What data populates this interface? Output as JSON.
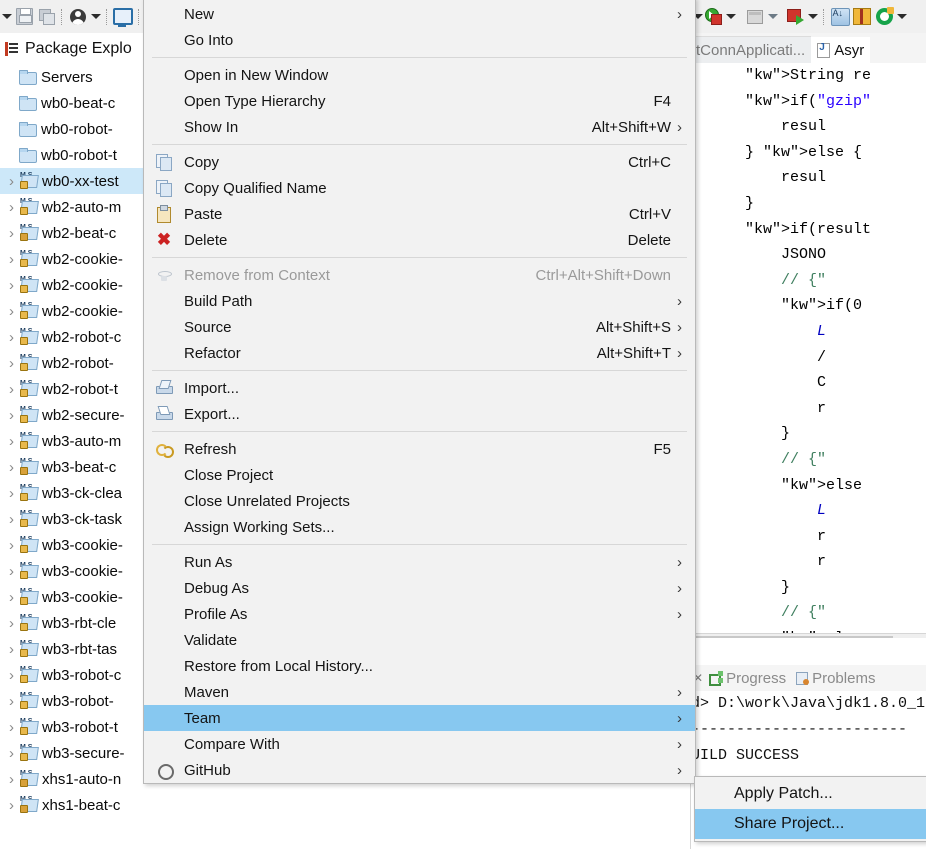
{
  "toolbar": {
    "left_icons": [
      "save-icon",
      "save-all-icon",
      "person-icon",
      "dropdown-arrow",
      "screen-icon"
    ],
    "right_icons": [
      "run-icon",
      "run-dropdown-arrow",
      "external-tools-icon",
      "external-dropdown-arrow",
      "debug-icon",
      "debug-dropdown-arrow",
      "sort-members-icon",
      "new-package-icon",
      "green-refresh-icon"
    ]
  },
  "package_explorer": {
    "title": "Package Explo",
    "items": [
      {
        "label": "Servers",
        "icon": "folder-icon",
        "twisty": false,
        "selected": false,
        "kind": "folder"
      },
      {
        "label": "wb0-beat-c",
        "icon": "folder-icon",
        "twisty": false,
        "selected": false,
        "kind": "folder"
      },
      {
        "label": "wb0-robot-",
        "icon": "folder-icon",
        "twisty": false,
        "selected": false,
        "kind": "folder"
      },
      {
        "label": "wb0-robot-t",
        "icon": "folder-icon",
        "twisty": false,
        "selected": false,
        "kind": "folder"
      },
      {
        "label": "wb0-xx-test",
        "icon": "maven-project-icon",
        "twisty": true,
        "selected": true,
        "kind": "project"
      },
      {
        "label": "wb2-auto-m",
        "icon": "maven-project-icon",
        "twisty": true,
        "selected": false,
        "kind": "project"
      },
      {
        "label": "wb2-beat-c",
        "icon": "maven-project-icon",
        "twisty": true,
        "selected": false,
        "kind": "project-warn"
      },
      {
        "label": "wb2-cookie-",
        "icon": "maven-project-icon",
        "twisty": true,
        "selected": false,
        "kind": "project"
      },
      {
        "label": "wb2-cookie-",
        "icon": "maven-project-icon",
        "twisty": true,
        "selected": false,
        "kind": "project"
      },
      {
        "label": "wb2-cookie-",
        "icon": "maven-project-icon",
        "twisty": true,
        "selected": false,
        "kind": "project"
      },
      {
        "label": "wb2-robot-c",
        "icon": "maven-project-icon",
        "twisty": true,
        "selected": false,
        "kind": "project"
      },
      {
        "label": "wb2-robot-",
        "icon": "maven-project-icon",
        "twisty": true,
        "selected": false,
        "kind": "project"
      },
      {
        "label": "wb2-robot-t",
        "icon": "maven-project-icon",
        "twisty": true,
        "selected": false,
        "kind": "project"
      },
      {
        "label": "wb2-secure-",
        "icon": "maven-project-icon",
        "twisty": true,
        "selected": false,
        "kind": "project"
      },
      {
        "label": "wb3-auto-m",
        "icon": "maven-project-icon",
        "twisty": true,
        "selected": false,
        "kind": "project"
      },
      {
        "label": "wb3-beat-c",
        "icon": "maven-project-icon",
        "twisty": true,
        "selected": false,
        "kind": "project-warn"
      },
      {
        "label": "wb3-ck-clea",
        "icon": "maven-project-icon",
        "twisty": true,
        "selected": false,
        "kind": "project"
      },
      {
        "label": "wb3-ck-task",
        "icon": "maven-project-icon",
        "twisty": true,
        "selected": false,
        "kind": "project"
      },
      {
        "label": "wb3-cookie-",
        "icon": "maven-project-icon",
        "twisty": true,
        "selected": false,
        "kind": "project"
      },
      {
        "label": "wb3-cookie-",
        "icon": "maven-project-icon",
        "twisty": true,
        "selected": false,
        "kind": "project"
      },
      {
        "label": "wb3-cookie-",
        "icon": "maven-project-icon",
        "twisty": true,
        "selected": false,
        "kind": "project"
      },
      {
        "label": "wb3-rbt-cle",
        "icon": "maven-project-icon",
        "twisty": true,
        "selected": false,
        "kind": "project"
      },
      {
        "label": "wb3-rbt-tas",
        "icon": "maven-project-icon",
        "twisty": true,
        "selected": false,
        "kind": "project"
      },
      {
        "label": "wb3-robot-c",
        "icon": "maven-project-icon",
        "twisty": true,
        "selected": false,
        "kind": "project"
      },
      {
        "label": "wb3-robot-",
        "icon": "maven-project-icon",
        "twisty": true,
        "selected": false,
        "kind": "project"
      },
      {
        "label": "wb3-robot-t",
        "icon": "maven-project-icon",
        "twisty": true,
        "selected": false,
        "kind": "project"
      },
      {
        "label": "wb3-secure-",
        "icon": "maven-project-icon",
        "twisty": true,
        "selected": false,
        "kind": "project"
      },
      {
        "label": "xhs1-auto-n",
        "icon": "maven-project-icon",
        "twisty": true,
        "selected": false,
        "kind": "project-warn"
      },
      {
        "label": "xhs1-beat-c",
        "icon": "maven-project-icon",
        "twisty": true,
        "selected": false,
        "kind": "project-warn"
      }
    ]
  },
  "context_menu": {
    "groups": [
      [
        {
          "label": "New",
          "accel": "",
          "submenu": true,
          "icon": "",
          "disabled": false
        },
        {
          "label": "Go Into",
          "accel": "",
          "submenu": false,
          "icon": "",
          "disabled": false
        }
      ],
      [
        {
          "label": "Open in New Window",
          "accel": "",
          "submenu": false,
          "icon": "",
          "disabled": false
        },
        {
          "label": "Open Type Hierarchy",
          "accel": "F4",
          "submenu": false,
          "icon": "",
          "disabled": false
        },
        {
          "label": "Show In",
          "accel": "Alt+Shift+W",
          "submenu": true,
          "icon": "",
          "disabled": false
        }
      ],
      [
        {
          "label": "Copy",
          "accel": "Ctrl+C",
          "submenu": false,
          "icon": "copy-icon",
          "disabled": false
        },
        {
          "label": "Copy Qualified Name",
          "accel": "",
          "submenu": false,
          "icon": "copy-qualified-icon",
          "disabled": false
        },
        {
          "label": "Paste",
          "accel": "Ctrl+V",
          "submenu": false,
          "icon": "paste-icon",
          "disabled": false
        },
        {
          "label": "Delete",
          "accel": "Delete",
          "submenu": false,
          "icon": "delete-icon",
          "disabled": false
        }
      ],
      [
        {
          "label": "Remove from Context",
          "accel": "Ctrl+Alt+Shift+Down",
          "submenu": false,
          "icon": "remove-context-icon",
          "disabled": true
        },
        {
          "label": "Build Path",
          "accel": "",
          "submenu": true,
          "icon": "",
          "disabled": false
        },
        {
          "label": "Source",
          "accel": "Alt+Shift+S",
          "submenu": true,
          "icon": "",
          "disabled": false
        },
        {
          "label": "Refactor",
          "accel": "Alt+Shift+T",
          "submenu": true,
          "icon": "",
          "disabled": false
        }
      ],
      [
        {
          "label": "Import...",
          "accel": "",
          "submenu": false,
          "icon": "import-icon",
          "disabled": false
        },
        {
          "label": "Export...",
          "accel": "",
          "submenu": false,
          "icon": "export-icon",
          "disabled": false
        }
      ],
      [
        {
          "label": "Refresh",
          "accel": "F5",
          "submenu": false,
          "icon": "refresh-icon",
          "disabled": false
        },
        {
          "label": "Close Project",
          "accel": "",
          "submenu": false,
          "icon": "",
          "disabled": false
        },
        {
          "label": "Close Unrelated Projects",
          "accel": "",
          "submenu": false,
          "icon": "",
          "disabled": false
        },
        {
          "label": "Assign Working Sets...",
          "accel": "",
          "submenu": false,
          "icon": "",
          "disabled": false
        }
      ],
      [
        {
          "label": "Run As",
          "accel": "",
          "submenu": true,
          "icon": "",
          "disabled": false
        },
        {
          "label": "Debug As",
          "accel": "",
          "submenu": true,
          "icon": "",
          "disabled": false
        },
        {
          "label": "Profile As",
          "accel": "",
          "submenu": true,
          "icon": "",
          "disabled": false
        },
        {
          "label": "Validate",
          "accel": "",
          "submenu": false,
          "icon": "",
          "disabled": false
        },
        {
          "label": "Restore from Local History...",
          "accel": "",
          "submenu": false,
          "icon": "",
          "disabled": false
        },
        {
          "label": "Maven",
          "accel": "",
          "submenu": true,
          "icon": "",
          "disabled": false
        },
        {
          "label": "Team",
          "accel": "",
          "submenu": true,
          "icon": "",
          "disabled": false,
          "selected": true
        },
        {
          "label": "Compare With",
          "accel": "",
          "submenu": true,
          "icon": "",
          "disabled": false
        },
        {
          "label": "GitHub",
          "accel": "",
          "submenu": true,
          "icon": "github-icon",
          "disabled": false
        }
      ]
    ]
  },
  "submenu": {
    "items": [
      {
        "label": "Apply Patch...",
        "selected": false
      },
      {
        "label": "Share Project...",
        "selected": true
      }
    ]
  },
  "editor": {
    "tabs": [
      {
        "label": "tConnApplicati...",
        "active": false,
        "icon": ""
      },
      {
        "label": "Asyr",
        "active": true,
        "icon": "java-file-icon"
      }
    ],
    "code_lines": [
      "String re",
      "if(\"gzip\"",
      "    resul",
      "} else {",
      "    resul",
      "}",
      "if(result",
      "    JSONO",
      "    // {\"",
      "    if(0",
      "        L",
      "        /",
      "        C",
      "        r",
      "    }",
      "    // {\"",
      "    else",
      "        L",
      "        r",
      "        r",
      "    }",
      "    // {\"",
      "    else"
    ]
  },
  "bottom_view": {
    "close_icon": "close-icon",
    "tabs": [
      {
        "label": "Progress",
        "icon": "progress-icon"
      },
      {
        "label": "Problems",
        "icon": "problems-icon"
      }
    ],
    "console_lines": [
      "d> D:\\work\\Java\\jdk1.8.0_1",
      "------------------------",
      "UILD SUCCESS",
      "------------------------"
    ]
  },
  "colors": {
    "menu_bg": "#f2f2f2",
    "menu_highlight": "#87c8f0",
    "tree_selected": "#cde8f9",
    "keyword": "#7f0055",
    "string": "#2a00ff",
    "comment": "#3f7f5f",
    "field": "#0000c0"
  }
}
